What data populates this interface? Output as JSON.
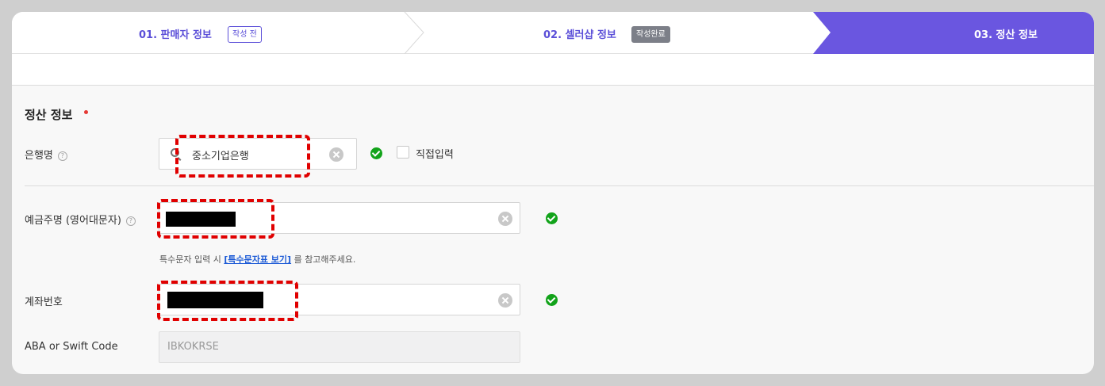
{
  "stepper": {
    "step1": {
      "label": "01. 판매자 정보",
      "badge": "작성 전"
    },
    "step2": {
      "label": "02. 셀러샵 정보",
      "badge": "작성완료"
    },
    "step3": {
      "label": "03. 정산 정보"
    }
  },
  "section": {
    "title": "정산 정보"
  },
  "bank": {
    "label": "은행명",
    "value": "중소기업은행",
    "manual_label": "직접입력"
  },
  "depositor": {
    "label": "예금주명 (영어대문자)",
    "hint_prefix": "특수문자 입력 시 ",
    "hint_link": "[특수문자표 보기]",
    "hint_suffix": " 를 참고해주세요."
  },
  "account": {
    "label": "계좌번호"
  },
  "swift": {
    "label": "ABA or Swift Code",
    "value": "IBKOKRSE"
  },
  "colors": {
    "accent": "#5b4fd8",
    "active_step": "#6a56e0",
    "success": "#12a31a",
    "highlight": "#e00000"
  }
}
